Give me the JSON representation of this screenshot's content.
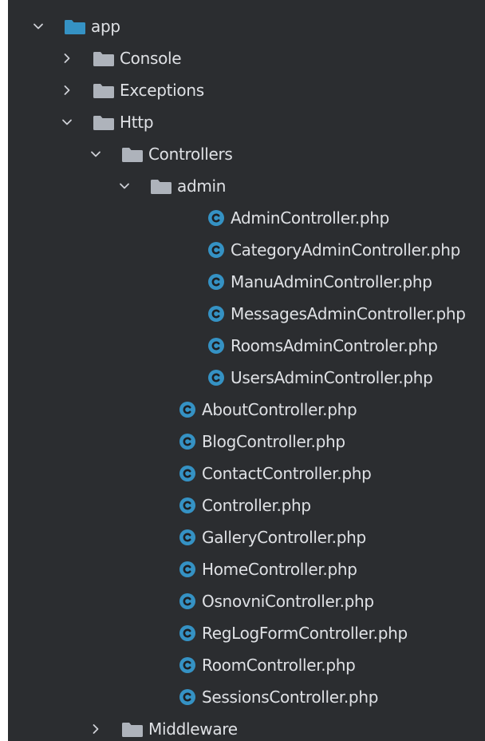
{
  "project_tree": {
    "nodes": [
      {
        "name": "app",
        "kind": "folder",
        "expanded": true,
        "icon": "folder-blue-icon"
      },
      {
        "name": "Console",
        "kind": "folder",
        "expanded": false,
        "icon": "folder-icon"
      },
      {
        "name": "Exceptions",
        "kind": "folder",
        "expanded": false,
        "icon": "folder-icon"
      },
      {
        "name": "Http",
        "kind": "folder",
        "expanded": true,
        "icon": "folder-icon"
      },
      {
        "name": "Controllers",
        "kind": "folder",
        "expanded": true,
        "icon": "folder-icon"
      },
      {
        "name": "admin",
        "kind": "folder",
        "expanded": true,
        "icon": "folder-icon"
      },
      {
        "name": "AdminController.php",
        "kind": "file",
        "icon": "php-class-icon"
      },
      {
        "name": "CategoryAdminController.php",
        "kind": "file",
        "icon": "php-class-icon"
      },
      {
        "name": "ManuAdminController.php",
        "kind": "file",
        "icon": "php-class-icon"
      },
      {
        "name": "MessagesAdminController.php",
        "kind": "file",
        "icon": "php-class-icon"
      },
      {
        "name": "RoomsAdminControler.php",
        "kind": "file",
        "icon": "php-class-icon"
      },
      {
        "name": "UsersAdminController.php",
        "kind": "file",
        "icon": "php-class-icon"
      },
      {
        "name": "AboutController.php",
        "kind": "file",
        "icon": "php-class-icon"
      },
      {
        "name": "BlogController.php",
        "kind": "file",
        "icon": "php-class-icon"
      },
      {
        "name": "ContactController.php",
        "kind": "file",
        "icon": "php-class-icon"
      },
      {
        "name": "Controller.php",
        "kind": "file",
        "icon": "php-class-icon"
      },
      {
        "name": "GalleryController.php",
        "kind": "file",
        "icon": "php-class-icon"
      },
      {
        "name": "HomeController.php",
        "kind": "file",
        "icon": "php-class-icon"
      },
      {
        "name": "OsnovniController.php",
        "kind": "file",
        "icon": "php-class-icon"
      },
      {
        "name": "RegLogFormController.php",
        "kind": "file",
        "icon": "php-class-icon"
      },
      {
        "name": "RoomController.php",
        "kind": "file",
        "icon": "php-class-icon"
      },
      {
        "name": "SessionsController.php",
        "kind": "file",
        "icon": "php-class-icon"
      },
      {
        "name": "Middleware",
        "kind": "folder",
        "expanded": false,
        "icon": "folder-icon"
      }
    ]
  },
  "colors": {
    "panel_background": "#2b2d30",
    "text": "#dfe1e5",
    "folder_module": "#3592c4",
    "folder_regular": "#aeb3bb",
    "class_icon": "#3592c4",
    "chevron": "#ced0d6"
  }
}
